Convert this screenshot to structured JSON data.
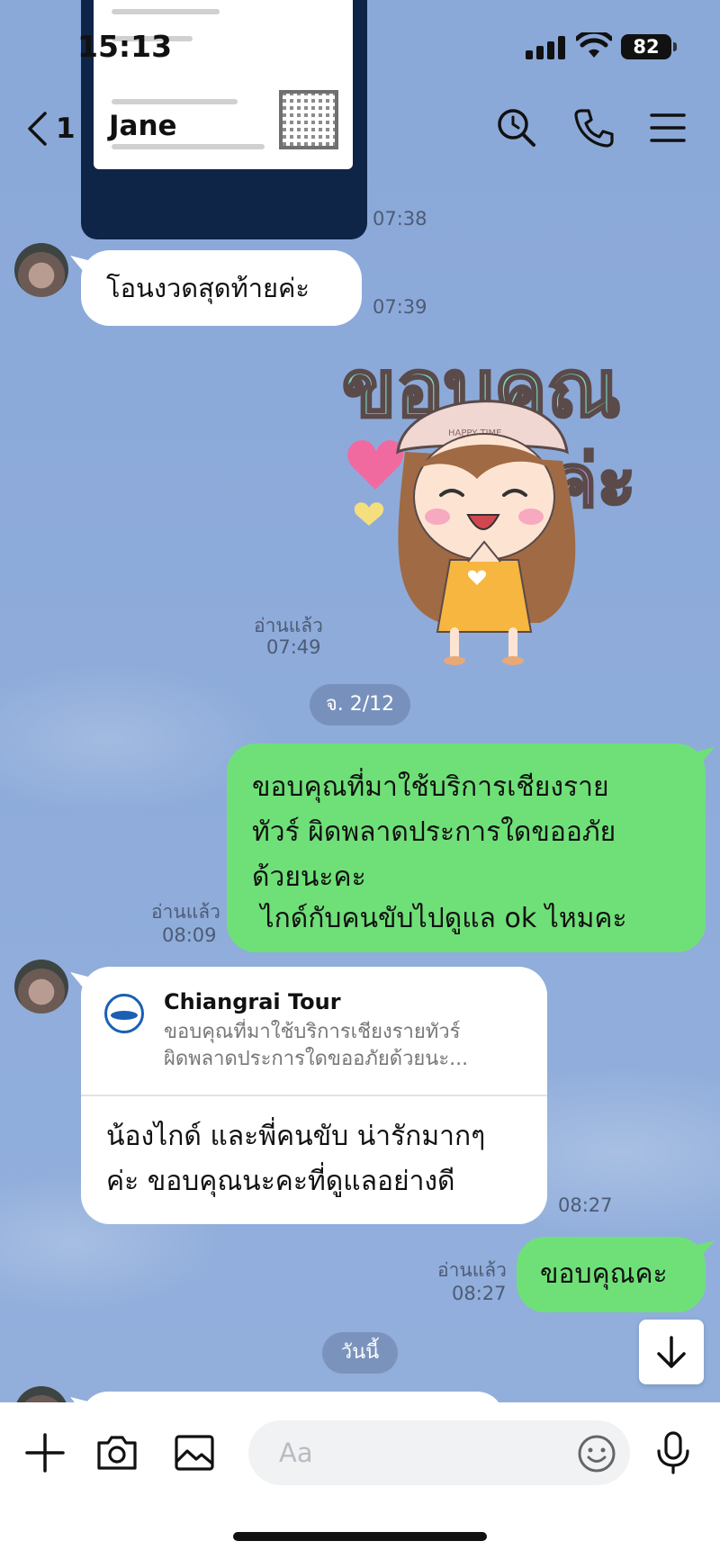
{
  "status_bar": {
    "time": "15:13",
    "battery": "82"
  },
  "header": {
    "back_count": "1",
    "title": "Jane"
  },
  "messages": {
    "image_time": "07:38",
    "m1": {
      "text": "โอนงวดสุดท้ายค่ะ",
      "time": "07:39"
    },
    "sticker": {
      "read": "อ่านแล้ว",
      "time": "07:49",
      "text_line1": "ขอบคุณ",
      "text_line2": "ค่ะ",
      "hat_text": "HAPPY TIME"
    },
    "date1": "จ. 2/12",
    "m2": {
      "lines": [
        "ขอบคุณที่มาใช้บริการเชียงราย",
        "ทัวร์ ผิดพลาดประการใดขออภัย",
        "ด้วยนะคะ",
        " ไกด์กับคนขับไปดูแล ok ไหมคะ"
      ],
      "read": "อ่านแล้ว",
      "time": "08:09"
    },
    "m3": {
      "reply_name": "Chiangrai Tour",
      "reply_preview_1": "ขอบคุณที่มาใช้บริการเชียงรายทัวร์",
      "reply_preview_2": "ผิดพลาดประการใดขออภัยด้วยนะ...",
      "lines": [
        "น้องไกด์ และพี่คนขับ น่ารักมากๆ",
        "ค่ะ ขอบคุณนะคะที่ดูแลอย่างดี"
      ],
      "time": "08:27"
    },
    "m4": {
      "text": "ขอบคุณคะ",
      "read": "อ่านแล้ว",
      "time": "08:27"
    },
    "date2": "วันนี้"
  },
  "input": {
    "placeholder": "Aa"
  },
  "colors": {
    "chat_bg": "#8aa7d6",
    "outgoing": "#6fe078",
    "incoming": "#ffffff"
  }
}
